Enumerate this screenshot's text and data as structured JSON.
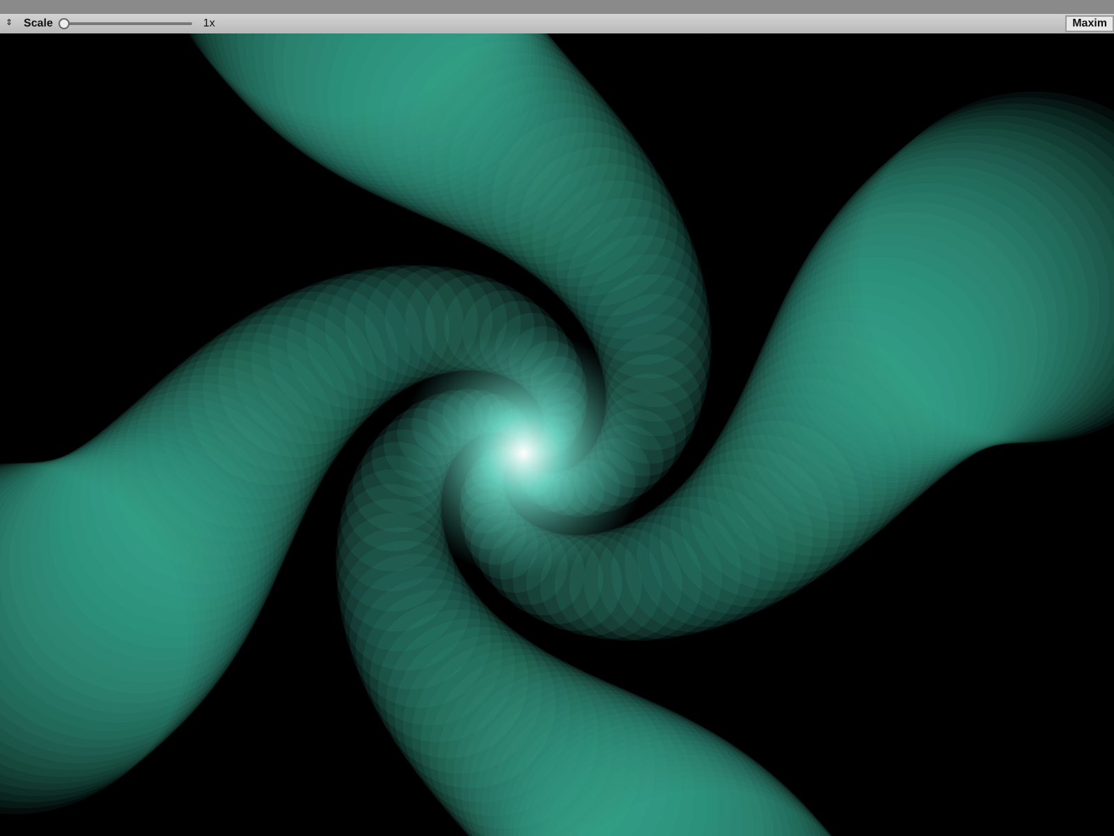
{
  "toolbar": {
    "left_handle": "⇕",
    "scale_label": "Scale",
    "scale_slider": {
      "level": 0
    },
    "scale_value": "1x",
    "maximize_button": "Maxim"
  }
}
